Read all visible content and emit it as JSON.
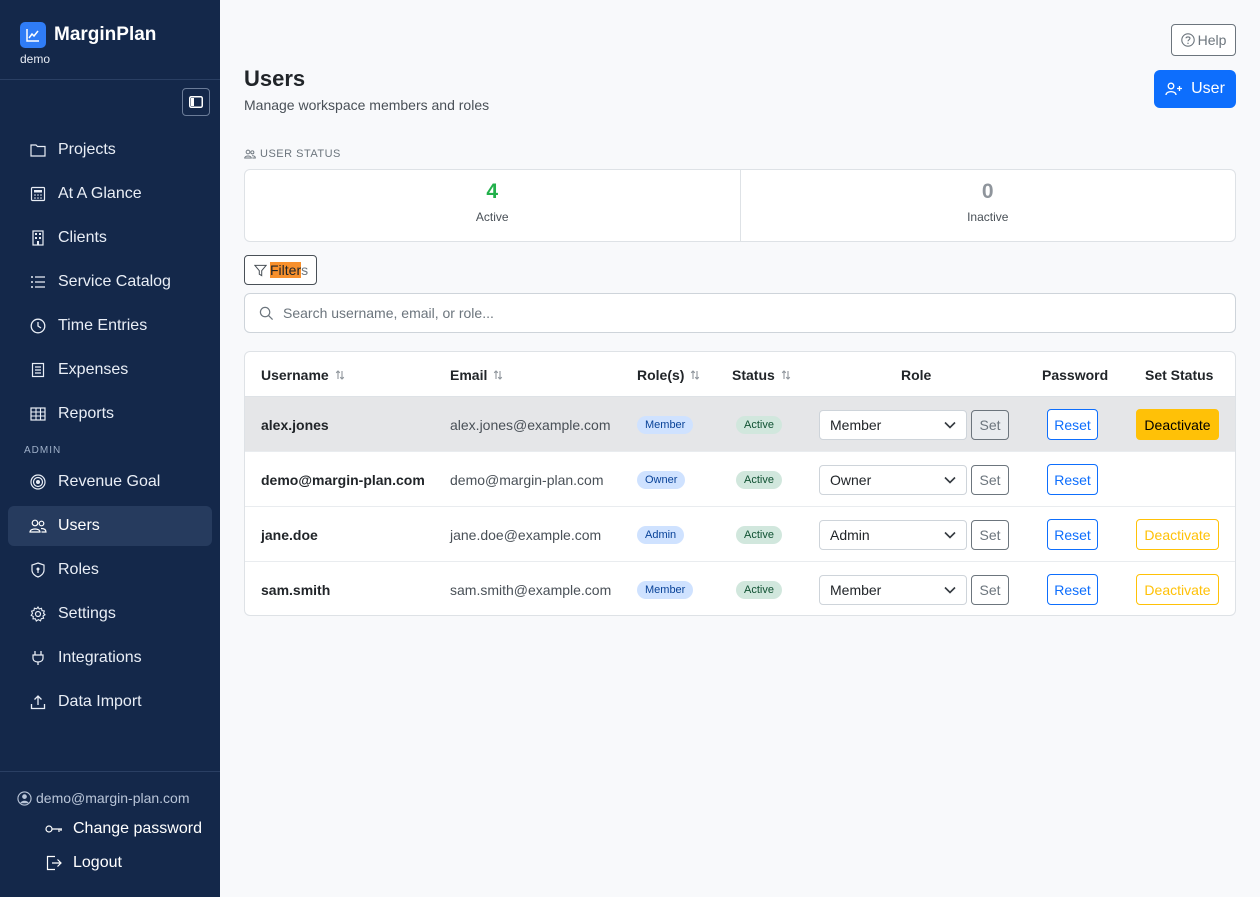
{
  "app": {
    "name": "MarginPlan",
    "workspace": "demo"
  },
  "sidebar": {
    "items": [
      {
        "label": "Projects",
        "icon": "folder-icon"
      },
      {
        "label": "At A Glance",
        "icon": "calculator-icon"
      },
      {
        "label": "Clients",
        "icon": "building-icon"
      },
      {
        "label": "Service Catalog",
        "icon": "list-icon"
      },
      {
        "label": "Time Entries",
        "icon": "clock-icon"
      },
      {
        "label": "Expenses",
        "icon": "receipt-icon"
      },
      {
        "label": "Reports",
        "icon": "table-icon"
      }
    ],
    "admin_label": "ADMIN",
    "admin_items": [
      {
        "label": "Revenue Goal",
        "icon": "target-icon"
      },
      {
        "label": "Users",
        "icon": "people-icon",
        "active": true
      },
      {
        "label": "Roles",
        "icon": "shield-icon"
      },
      {
        "label": "Settings",
        "icon": "gear-icon"
      },
      {
        "label": "Integrations",
        "icon": "plug-icon"
      },
      {
        "label": "Data Import",
        "icon": "upload-icon"
      }
    ],
    "footer": {
      "email": "demo@margin-plan.com",
      "change_password": "Change password",
      "logout": "Logout"
    }
  },
  "header": {
    "help": "Help",
    "title": "Users",
    "subtitle": "Manage workspace members and roles",
    "add_button": "User"
  },
  "status": {
    "heading": "USER STATUS",
    "active_count": "4",
    "active_label": "Active",
    "inactive_count": "0",
    "inactive_label": "Inactive",
    "active_color": "#22b04b",
    "inactive_color": "#8f959c"
  },
  "filters": {
    "label_highlighted": "Filter",
    "label_rest": "s"
  },
  "search": {
    "placeholder": "Search username, email, or role..."
  },
  "table": {
    "headers": {
      "username": "Username",
      "email": "Email",
      "roles": "Role(s)",
      "status": "Status",
      "role": "Role",
      "password": "Password",
      "set_status": "Set Status"
    },
    "rows": [
      {
        "username": "alex.jones",
        "email": "alex.jones@example.com",
        "role_badge": "Member",
        "status": "Active",
        "role_select": "Member",
        "set": "Set",
        "reset": "Reset",
        "set_status": "Deactivate"
      },
      {
        "username": "demo@margin-plan.com",
        "email": "demo@margin-plan.com",
        "role_badge": "Owner",
        "status": "Active",
        "role_select": "Owner",
        "set": "Set",
        "reset": "Reset",
        "set_status": ""
      },
      {
        "username": "jane.doe",
        "email": "jane.doe@example.com",
        "role_badge": "Admin",
        "status": "Active",
        "role_select": "Admin",
        "set": "Set",
        "reset": "Reset",
        "set_status": "Deactivate"
      },
      {
        "username": "sam.smith",
        "email": "sam.smith@example.com",
        "role_badge": "Member",
        "status": "Active",
        "role_select": "Member",
        "set": "Set",
        "reset": "Reset",
        "set_status": "Deactivate"
      }
    ]
  },
  "colors": {
    "sidebar_bg": "#14284a",
    "primary": "#0d6efd",
    "warning": "#ffc107",
    "highlight": "#f7902d"
  }
}
